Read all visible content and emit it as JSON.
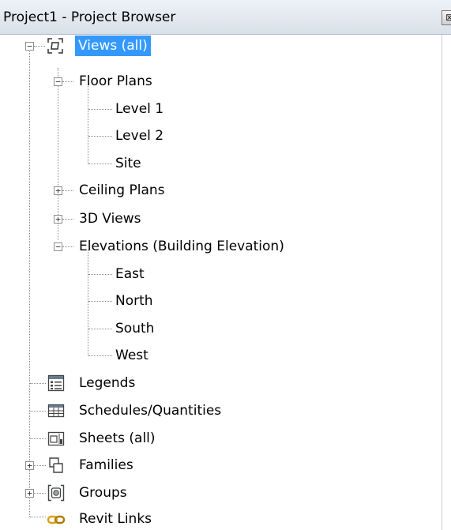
{
  "title": "Project1 - Project Browser",
  "close_glyph": "⊠",
  "tree": {
    "views_all": "Views (all)",
    "floor_plans": "Floor Plans",
    "floor_plan_items": [
      "Level 1",
      "Level 2",
      "Site"
    ],
    "ceiling_plans": "Ceiling Plans",
    "views_3d": "3D Views",
    "elevations": "Elevations (Building Elevation)",
    "elevation_items": [
      "East",
      "North",
      "South",
      "West"
    ],
    "legends": "Legends",
    "schedules": "Schedules/Quantities",
    "sheets": "Sheets (all)",
    "families": "Families",
    "groups": "Groups",
    "revit_links": "Revit Links"
  },
  "toggles": {
    "collapse": "−",
    "expand": "+"
  },
  "colors": {
    "selection": "#3399ff",
    "revit_links_icon": "#d9a014"
  },
  "icons": [
    "views-icon",
    "legends-icon",
    "schedules-icon",
    "sheets-icon",
    "families-icon",
    "groups-icon",
    "revit-links-icon"
  ]
}
